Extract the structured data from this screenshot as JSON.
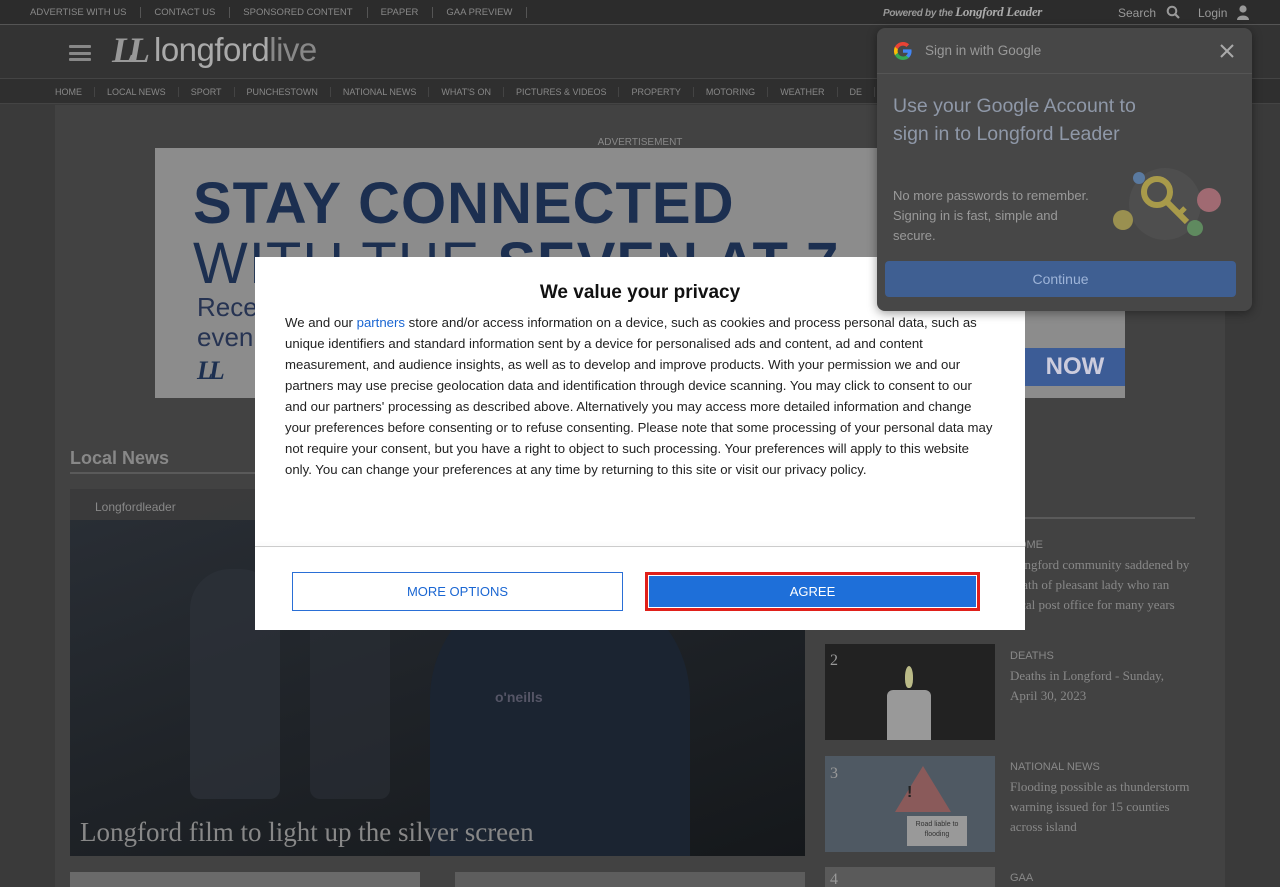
{
  "topbar": {
    "links": [
      "ADVERTISE WITH US",
      "CONTACT US",
      "SPONSORED CONTENT",
      "EPAPER",
      "GAA PREVIEW"
    ],
    "powered_prefix": "Powered by the",
    "powered_brand": "Longford Leader",
    "search_label": "Search",
    "login_label": "Login"
  },
  "header": {
    "logo_mark": "LL",
    "logo_name_a": "longford",
    "logo_name_b": "live"
  },
  "nav": {
    "items": [
      "HOME",
      "LOCAL NEWS",
      "SPORT",
      "PUNCHESTOWN",
      "NATIONAL NEWS",
      "WHAT'S ON",
      "PICTURES & VIDEOS",
      "PROPERTY",
      "MOTORING",
      "WEATHER",
      "DE"
    ]
  },
  "ad": {
    "label": "ADVERTISEMENT",
    "line1": "STAY CONNECTED",
    "line2a": "WITH THE ",
    "line2b": "SEVEN AT 7",
    "line3": "Rece",
    "line4": "even",
    "mark": "LL",
    "cta": "NOW"
  },
  "local_news": {
    "title": "Local News",
    "hero": {
      "source": "Longfordleader",
      "shirt_text": "o'neills",
      "headline": "Longford film to light up the silver screen"
    }
  },
  "most_read": [
    {
      "rank": "",
      "category": "HOME",
      "title": "Longford community saddened by death of pleasant lady who ran local post office for many years"
    },
    {
      "rank": "2",
      "category": "DEATHS",
      "title": "Deaths in Longford - Sunday, April 30, 2023"
    },
    {
      "rank": "3",
      "category": "NATIONAL NEWS",
      "title": "Flooding possible as thunderstorm warning issued for 15 counties across island"
    },
    {
      "rank": "4",
      "category": "GAA",
      "title": ""
    }
  ],
  "thumb3": {
    "sign_text": "!",
    "plate_text": "Road liable to flooding"
  },
  "privacy": {
    "title": "We value your privacy",
    "body_start": "We and our ",
    "partners_link": "partners",
    "body_rest": " store and/or access information on a device, such as cookies and process personal data, such as unique identifiers and standard information sent by a device for personalised ads and content, ad and content measurement, and audience insights, as well as to develop and improve products. With your permission we and our partners may use precise geolocation data and identification through device scanning. You may click to consent to our and our partners' processing as described above. Alternatively you may access more detailed information and change your preferences before consenting or to refuse consenting. Please note that some processing of your personal data may not require your consent, but you have a right to object to such processing. Your preferences will apply to this website only. You can change your preferences at any time by returning to this site or visit our privacy policy.",
    "more_options": "MORE OPTIONS",
    "agree": "AGREE"
  },
  "google": {
    "title": "Sign in with Google",
    "heading": "Use your Google Account to sign in to Longford Leader",
    "subtext": "No more passwords to remember. Signing in is fast, simple and secure.",
    "continue": "Continue"
  },
  "icons": {
    "search": "search-icon",
    "user": "user-icon",
    "menu": "hamburger-icon",
    "google": "google-logo-icon",
    "close": "close-icon",
    "key": "key-illustration-icon"
  },
  "colors": {
    "agree_bg": "#1e6fd9",
    "agree_border": "#e0201a",
    "link": "#1a66d2",
    "google_button": "#3f5f92"
  }
}
